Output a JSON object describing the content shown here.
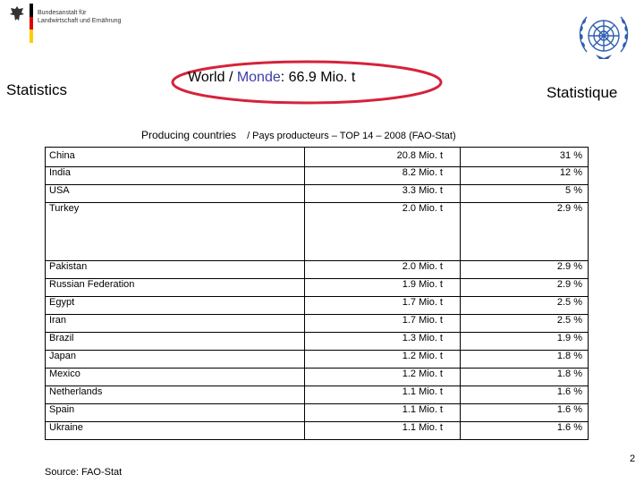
{
  "header": {
    "ministry_line1": "Bundesanstalt für",
    "ministry_line2": "Landwirtschaft und Ernährung",
    "title_left": "Statistics",
    "title_right": "Statistique"
  },
  "highlight": {
    "world_prefix": "World / ",
    "monde": "Monde",
    "world_value": ": 66.9 Mio. t"
  },
  "subtitle": {
    "part1": "Producing countries",
    "part2": "/ Pays producteurs – TOP 14 – 2008 (FAO-Stat)"
  },
  "table": {
    "rows": [
      {
        "country": "China",
        "production": "20.8 Mio. t",
        "share": "31 %"
      },
      {
        "country": "India",
        "production": "8.2 Mio. t",
        "share": "12 %"
      },
      {
        "country": "USA",
        "production": "3.3 Mio. t",
        "share": "5 %"
      },
      {
        "country": "Turkey",
        "production": "2.0 Mio. t",
        "share": "2.9 %"
      },
      {
        "country": "Pakistan",
        "production": "2.0 Mio. t",
        "share": "2.9 %"
      },
      {
        "country": "Russian Federation",
        "production": "1.9 Mio. t",
        "share": "2.9 %"
      },
      {
        "country": "Egypt",
        "production": "1.7 Mio. t",
        "share": "2.5 %"
      },
      {
        "country": "Iran",
        "production": "1.7 Mio. t",
        "share": "2.5 %"
      },
      {
        "country": "Brazil",
        "production": "1.3 Mio. t",
        "share": "1.9 %"
      },
      {
        "country": "Japan",
        "production": "1.2 Mio. t",
        "share": "1.8 %"
      },
      {
        "country": "Mexico",
        "production": "1.2 Mio. t",
        "share": "1.8 %"
      },
      {
        "country": "Netherlands",
        "production": "1.1 Mio. t",
        "share": "1.6 %"
      },
      {
        "country": "Spain",
        "production": "1.1 Mio. t",
        "share": "1.6 %"
      },
      {
        "country": "Ukraine",
        "production": "1.1 Mio. t",
        "share": "1.6 %"
      }
    ]
  },
  "footer": {
    "source": "Source: FAO-Stat",
    "page_number": "2"
  },
  "colors": {
    "ellipse_border": "#d6223b",
    "monde_text": "#3c3ca8",
    "un_blue": "#2f5fb0",
    "flag_black": "#000000",
    "flag_red": "#dd0000",
    "flag_gold": "#ffce00"
  },
  "icons": {
    "left_logo": "federal-eagle-icon",
    "right_logo": "un-emblem-icon"
  }
}
